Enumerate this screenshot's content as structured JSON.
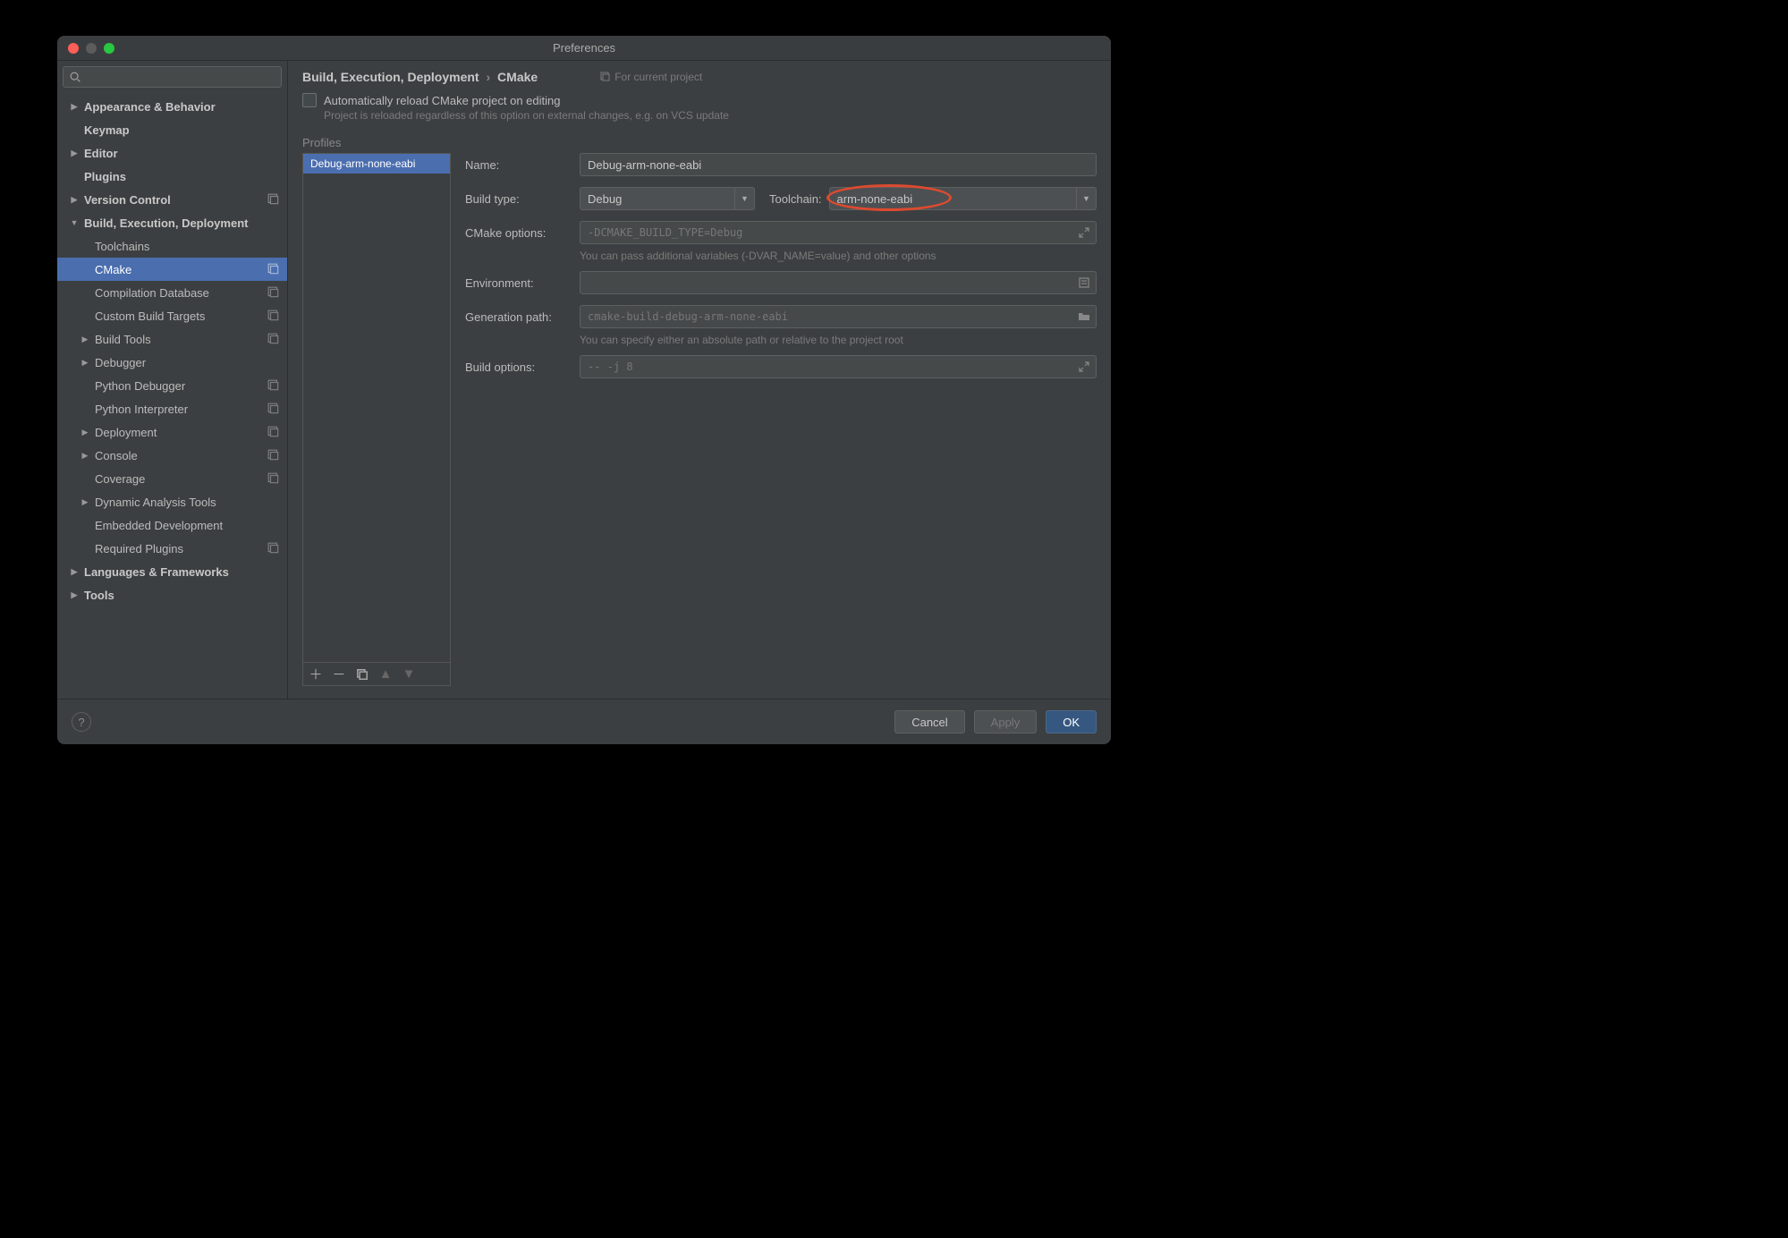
{
  "window": {
    "title": "Preferences"
  },
  "breadcrumb": {
    "section": "Build, Execution, Deployment",
    "page": "CMake",
    "scope": "For current project"
  },
  "checkbox": {
    "label": "Automatically reload CMake project on editing",
    "hint": "Project is reloaded regardless of this option on external changes, e.g. on VCS update"
  },
  "profiles": {
    "heading": "Profiles",
    "items": [
      "Debug-arm-none-eabi"
    ]
  },
  "form": {
    "name": {
      "label": "Name:",
      "value": "Debug-arm-none-eabi"
    },
    "build_type": {
      "label": "Build type:",
      "value": "Debug"
    },
    "toolchain": {
      "label": "Toolchain:",
      "value": "arm-none-eabi"
    },
    "cmake_options": {
      "label": "CMake options:",
      "placeholder": "-DCMAKE_BUILD_TYPE=Debug",
      "hint": "You can pass additional variables (-DVAR_NAME=value) and other options"
    },
    "environment": {
      "label": "Environment:"
    },
    "generation_path": {
      "label": "Generation path:",
      "placeholder": "cmake-build-debug-arm-none-eabi",
      "hint": "You can specify either an absolute path or relative to the project root"
    },
    "build_options": {
      "label": "Build options:",
      "placeholder": "-- -j 8"
    }
  },
  "sidebar": {
    "items": [
      {
        "label": "Appearance & Behavior",
        "level": 0,
        "arrow": "right"
      },
      {
        "label": "Keymap",
        "level": 0
      },
      {
        "label": "Editor",
        "level": 0,
        "arrow": "right"
      },
      {
        "label": "Plugins",
        "level": 0
      },
      {
        "label": "Version Control",
        "level": 0,
        "arrow": "right",
        "badge": true
      },
      {
        "label": "Build, Execution, Deployment",
        "level": 0,
        "arrow": "down"
      },
      {
        "label": "Toolchains",
        "level": 1
      },
      {
        "label": "CMake",
        "level": 1,
        "selected": true,
        "badge": true
      },
      {
        "label": "Compilation Database",
        "level": 1,
        "badge": true
      },
      {
        "label": "Custom Build Targets",
        "level": 1,
        "badge": true
      },
      {
        "label": "Build Tools",
        "level": 1,
        "arrow": "right",
        "badge": true
      },
      {
        "label": "Debugger",
        "level": 1,
        "arrow": "right"
      },
      {
        "label": "Python Debugger",
        "level": 1,
        "badge": true
      },
      {
        "label": "Python Interpreter",
        "level": 1,
        "badge": true
      },
      {
        "label": "Deployment",
        "level": 1,
        "arrow": "right",
        "badge": true
      },
      {
        "label": "Console",
        "level": 1,
        "arrow": "right",
        "badge": true
      },
      {
        "label": "Coverage",
        "level": 1,
        "badge": true
      },
      {
        "label": "Dynamic Analysis Tools",
        "level": 1,
        "arrow": "right"
      },
      {
        "label": "Embedded Development",
        "level": 1
      },
      {
        "label": "Required Plugins",
        "level": 1,
        "badge": true
      },
      {
        "label": "Languages & Frameworks",
        "level": 0,
        "arrow": "right"
      },
      {
        "label": "Tools",
        "level": 0,
        "arrow": "right"
      }
    ]
  },
  "footer": {
    "cancel": "Cancel",
    "apply": "Apply",
    "ok": "OK"
  }
}
